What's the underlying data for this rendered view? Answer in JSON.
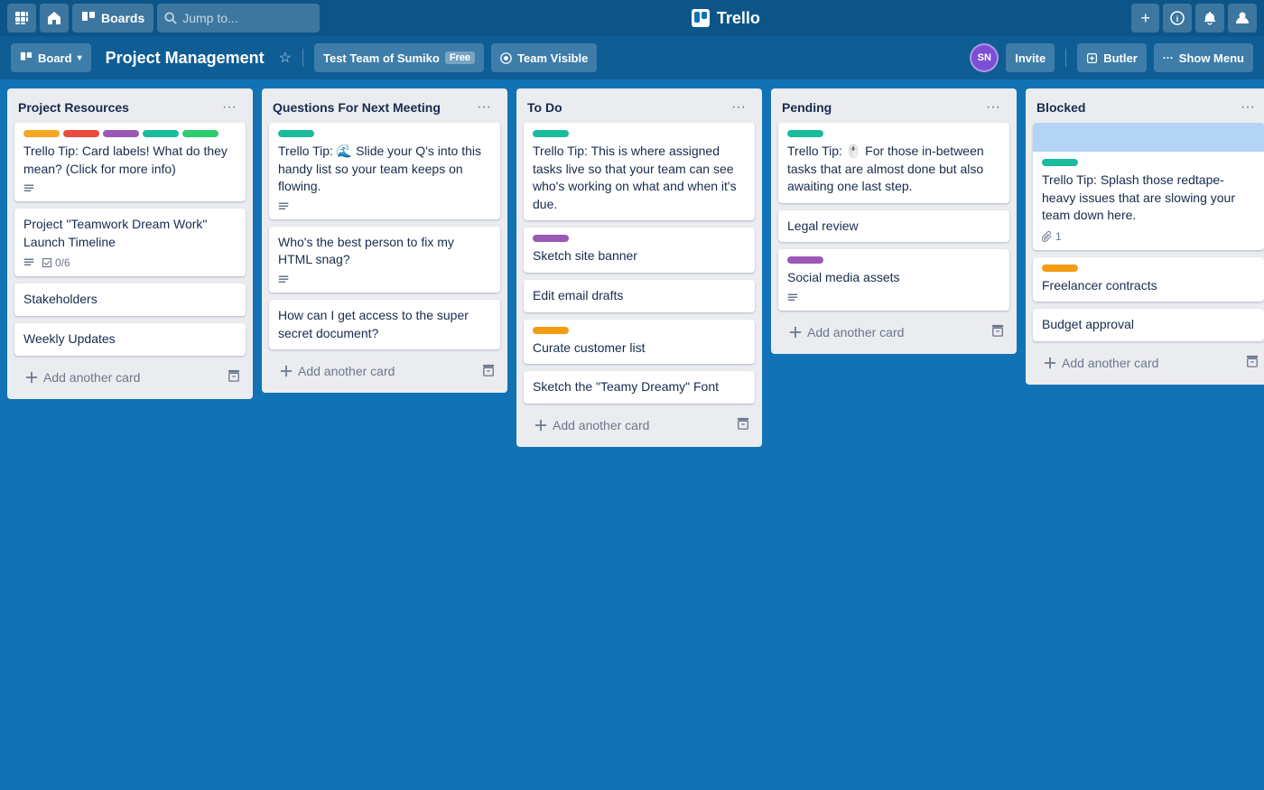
{
  "nav": {
    "boards_label": "Boards",
    "search_placeholder": "Jump to...",
    "logo_text": "Trello",
    "add_tooltip": "Create",
    "info_tooltip": "Info",
    "notif_tooltip": "Notifications",
    "profile_tooltip": "Profile"
  },
  "board_header": {
    "board_label": "Board",
    "title": "Project Management",
    "team_name": "Test Team of Sumiko",
    "team_badge": "Free",
    "team_visible_label": "Team Visible",
    "invite_label": "Invite",
    "butler_label": "Butler",
    "show_menu_label": "Show Menu",
    "avatar_initials": "SN"
  },
  "lists": [
    {
      "id": "project-resources",
      "title": "Project Resources",
      "cards": [
        {
          "id": "pr-1",
          "labels": [
            "#f5a623",
            "#e74c3c",
            "#9b59b6",
            "#1abc9c",
            "#2ecc71"
          ],
          "text": "Trello Tip: Card labels! What do they mean? (Click for more info)",
          "has_description": true
        },
        {
          "id": "pr-2",
          "labels": [],
          "text": "Project \"Teamwork Dream Work\" Launch Timeline",
          "has_description": true,
          "checklist": "0/6"
        },
        {
          "id": "pr-3",
          "labels": [],
          "text": "Stakeholders"
        },
        {
          "id": "pr-4",
          "labels": [],
          "text": "Weekly Updates"
        }
      ],
      "add_card_label": "Add another card"
    },
    {
      "id": "questions-next-meeting",
      "title": "Questions For Next Meeting",
      "cards": [
        {
          "id": "qnm-1",
          "labels": [
            "#1abc9c"
          ],
          "text": "Trello Tip: 🌊 Slide your Q's into this handy list so your team keeps on flowing.",
          "has_description": true
        },
        {
          "id": "qnm-2",
          "labels": [],
          "text": "Who's the best person to fix my HTML snag?",
          "has_description": true
        },
        {
          "id": "qnm-3",
          "labels": [],
          "text": "How can I get access to the super secret document?"
        }
      ],
      "add_card_label": "Add another card"
    },
    {
      "id": "to-do",
      "title": "To Do",
      "cards": [
        {
          "id": "td-1",
          "labels": [
            "#1abc9c"
          ],
          "text": "Trello Tip: This is where assigned tasks live so that your team can see who's working on what and when it's due."
        },
        {
          "id": "td-2",
          "labels": [
            "#9b59b6"
          ],
          "text": "Sketch site banner"
        },
        {
          "id": "td-3",
          "labels": [],
          "text": "Edit email drafts"
        },
        {
          "id": "td-4",
          "labels": [
            "#f39c12"
          ],
          "text": "Curate customer list"
        },
        {
          "id": "td-5",
          "labels": [],
          "text": "Sketch the \"Teamy Dreamy\" Font"
        }
      ],
      "add_card_label": "Add another card"
    },
    {
      "id": "pending",
      "title": "Pending",
      "cards": [
        {
          "id": "pend-1",
          "labels": [
            "#1abc9c"
          ],
          "text": "Trello Tip: 🖱️ For those in-between tasks that are almost done but also awaiting one last step."
        },
        {
          "id": "pend-2",
          "labels": [],
          "text": "Legal review"
        },
        {
          "id": "pend-3",
          "labels": [
            "#9b59b6"
          ],
          "text": "Social media assets",
          "has_description": true
        }
      ],
      "add_card_label": "Add another card"
    },
    {
      "id": "blocked",
      "title": "Blocked",
      "cards": [
        {
          "id": "bl-1",
          "labels": [
            "#1abc9c"
          ],
          "has_cover": true,
          "text": "Trello Tip: Splash those redtape-heavy issues that are slowing your team down here.",
          "attachment_count": "1"
        },
        {
          "id": "bl-2",
          "labels": [
            "#f39c12"
          ],
          "text": "Freelancer contracts"
        },
        {
          "id": "bl-3",
          "labels": [],
          "text": "Budget approval"
        }
      ],
      "add_card_label": "Add another card"
    }
  ],
  "icons": {
    "grid": "⊞",
    "home": "⌂",
    "boards_icon": "▦",
    "search": "🔍",
    "plus": "+",
    "info": "ⓘ",
    "bell": "🔔",
    "person": "👤",
    "chevron": "▾",
    "star": "☆",
    "ellipsis": "···",
    "description": "≡",
    "checklist": "☑",
    "attachment": "📎",
    "archive": "⊡",
    "add": "+",
    "shield": "🛡",
    "more": "···"
  }
}
